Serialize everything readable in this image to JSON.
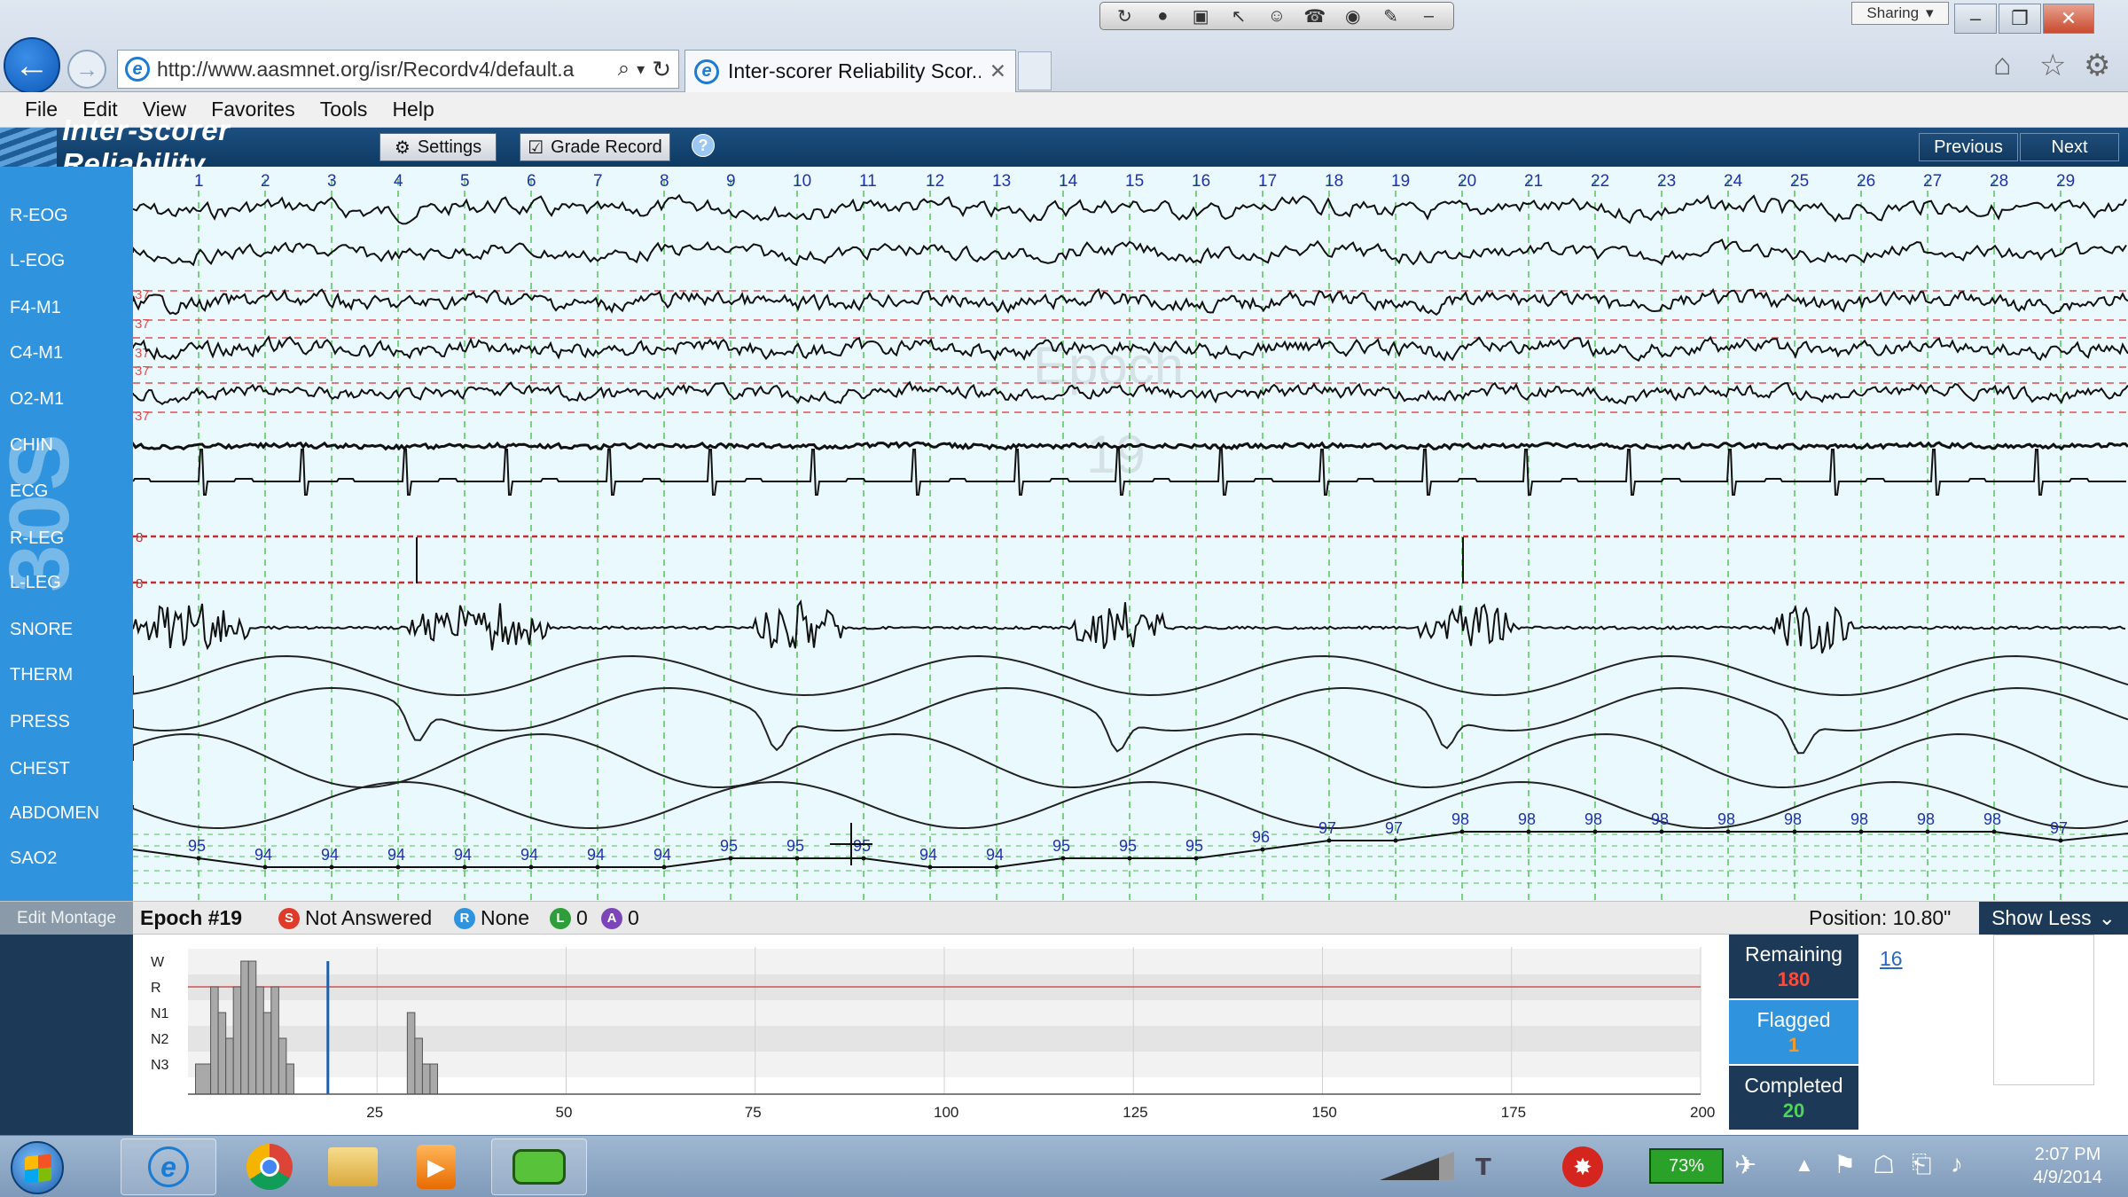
{
  "browser": {
    "url": "http://www.aasmnet.org/isr/Recordv4/default.a",
    "tab_title": "Inter-scorer Reliability Scor...",
    "sharing_label": "Sharing"
  },
  "menu": [
    "File",
    "Edit",
    "View",
    "Favorites",
    "Tools",
    "Help"
  ],
  "app": {
    "title": "Inter-scorer Reliability",
    "settings_label": "Settings",
    "grade_label": "Grade Record",
    "help_label": "?",
    "previous_label": "Previous",
    "next_label": "Next"
  },
  "channels": [
    "R-EOG",
    "L-EOG",
    "F4-M1",
    "C4-M1",
    "O2-M1",
    "CHIN",
    "ECG",
    "R-LEG",
    "L-LEG",
    "SNORE",
    "THERM",
    "PRESS",
    "CHEST",
    "ABDOMEN",
    "SAO2"
  ],
  "seconds": [
    "1",
    "2",
    "3",
    "4",
    "5",
    "6",
    "7",
    "8",
    "9",
    "10",
    "11",
    "12",
    "13",
    "14",
    "15",
    "16",
    "17",
    "18",
    "19",
    "20",
    "21",
    "22",
    "23",
    "24",
    "25",
    "26",
    "27",
    "28",
    "29"
  ],
  "eeg_scale_label": "37",
  "leg_scale_label": "8",
  "watermark_side": "30S",
  "watermark_center": [
    "Epoch",
    "19"
  ],
  "sao2_values": [
    "95",
    "94",
    "94",
    "94",
    "94",
    "94",
    "94",
    "94",
    "95",
    "95",
    "95",
    "94",
    "94",
    "95",
    "95",
    "95",
    "96",
    "97",
    "97",
    "98",
    "98",
    "98",
    "98",
    "98",
    "98",
    "98",
    "98",
    "98",
    "97"
  ],
  "status": {
    "edit_montage": "Edit Montage",
    "epoch": "Epoch #19",
    "s_badge": "S",
    "s_text": "Not Answered",
    "r_badge": "R",
    "r_text": "None",
    "l_badge": "L",
    "l_value": "0",
    "a_badge": "A",
    "a_value": "0",
    "position": "Position: 10.80\"",
    "show_less": "Show Less"
  },
  "hypnogram": {
    "stages": [
      "W",
      "R",
      "N1",
      "N2",
      "N3"
    ],
    "x_ticks": [
      "25",
      "50",
      "75",
      "100",
      "125",
      "150",
      "175",
      "200"
    ],
    "current_epoch": 19
  },
  "counters": {
    "remaining_label": "Remaining",
    "remaining_value": "180",
    "flagged_label": "Flagged",
    "flagged_value": "1",
    "completed_label": "Completed",
    "completed_value": "20",
    "link_value": "16"
  },
  "taskbar": {
    "battery": "73%",
    "time": "2:07 PM",
    "date": "4/9/2014"
  },
  "colors": {
    "left_panel": "#2f94dd",
    "trace_bg": "#eaf9fd",
    "app_bar": "#0e3a63",
    "remaining_value": "#ff4a3a",
    "flagged_value": "#f39a2a",
    "completed_value": "#4fd45a"
  }
}
